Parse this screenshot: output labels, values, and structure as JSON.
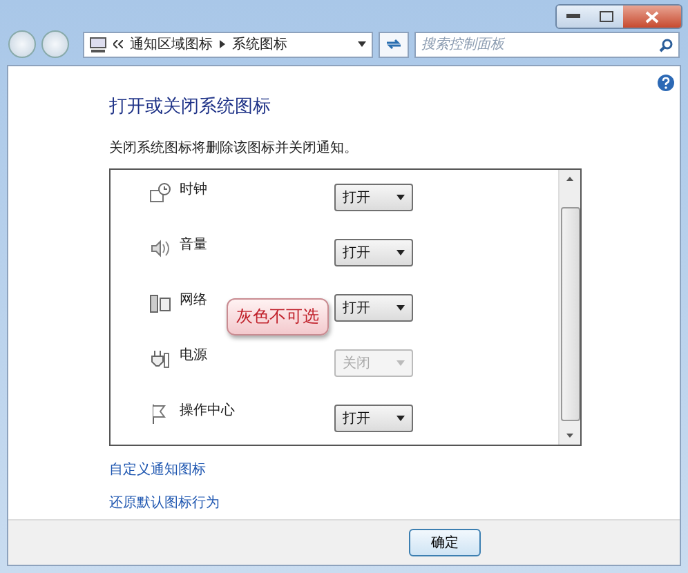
{
  "address_bar": {
    "crumbs": [
      "通知区域图标",
      "系统图标"
    ]
  },
  "search": {
    "placeholder": "搜索控制面板"
  },
  "heading": "打开或关闭系统图标",
  "description": "关闭系统图标将删除该图标并关闭通知。",
  "icons": [
    {
      "label": "时钟",
      "value": "打开",
      "disabled": false
    },
    {
      "label": "音量",
      "value": "打开",
      "disabled": false
    },
    {
      "label": "网络",
      "value": "打开",
      "disabled": false
    },
    {
      "label": "电源",
      "value": "关闭",
      "disabled": true
    },
    {
      "label": "操作中心",
      "value": "打开",
      "disabled": false
    }
  ],
  "callout": "灰色不可选",
  "links": [
    "自定义通知图标",
    "还原默认图标行为"
  ],
  "buttons": [
    "确定"
  ]
}
